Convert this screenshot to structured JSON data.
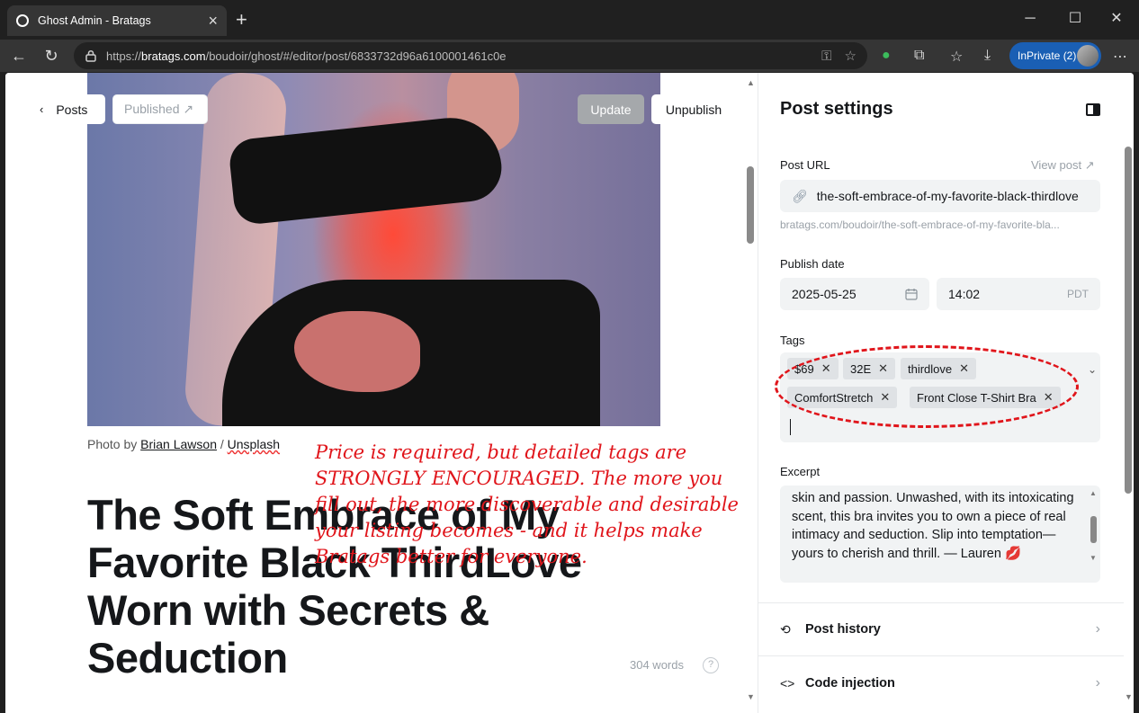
{
  "browser": {
    "tab_title": "Ghost Admin - Bratags",
    "url_prefix": "https://",
    "url_host": "bratags.com",
    "url_path": "/boudoir/ghost/#/editor/post/6833732d96a6100001461c0e",
    "inprivate_label": "InPrivate (2)"
  },
  "editor": {
    "posts_label": "Posts",
    "published_label": "Published ↗",
    "update_label": "Update",
    "unpublish_label": "Unpublish",
    "caption_prefix": "Photo by ",
    "photographer": "Brian Lawson",
    "caption_sep": " / ",
    "source": "Unsplash",
    "title": "The Soft Embrace of My Favorite Black ThirdLove Worn with Secrets & Seduction",
    "word_count": "304 words",
    "help_glyph": "?"
  },
  "annotation": {
    "text": "Price is required, but detailed tags are STRONGLY ENCOURAGED. The more you fill out, the more discoverable and desirable your listing becomes - and it helps make Bratags better for everyone.",
    "color": "#e0151b"
  },
  "settings": {
    "title": "Post settings",
    "post_url_label": "Post URL",
    "view_post_label": "View post ↗",
    "slug": "the-soft-embrace-of-my-favorite-black-thirdlove",
    "url_hint": "bratags.com/boudoir/the-soft-embrace-of-my-favorite-bla...",
    "publish_date_label": "Publish date",
    "date": "2025-05-25",
    "time": "14:02",
    "timezone": "PDT",
    "tags_label": "Tags",
    "tags": [
      "$69",
      "32E",
      "thirdlove",
      "ComfortStretch",
      "Front Close T-Shirt Bra"
    ],
    "excerpt_label": "Excerpt",
    "excerpt": "skin and passion. Unwashed, with its intoxicating scent, this bra invites you to own a piece of real intimacy and seduction. Slip into temptation—yours to cherish and thrill. — Lauren",
    "post_history_label": "Post history",
    "code_injection_label": "Code injection"
  },
  "icons": {
    "back": "arrow-left-icon",
    "refresh": "refresh-icon",
    "lock": "lock-icon",
    "calendar": "calendar-icon",
    "link": "link-icon",
    "history": "history-icon",
    "code": "code-icon",
    "kiss": "kiss-lips-icon"
  }
}
